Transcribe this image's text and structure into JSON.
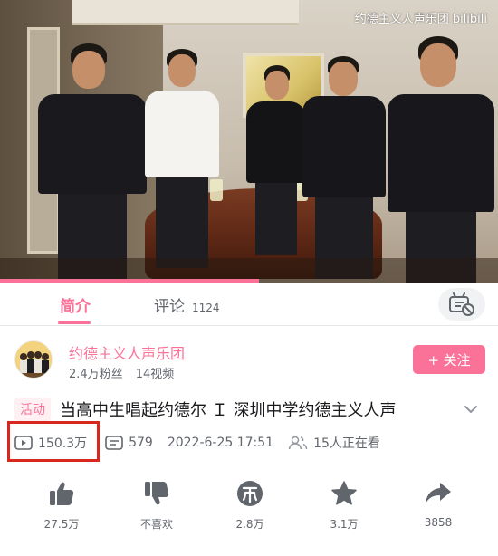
{
  "video": {
    "watermark": "约德主义人声乐团 bilibili",
    "progress_fraction": 0.52
  },
  "tabs": [
    {
      "label": "简介",
      "active": true
    },
    {
      "label": "评论",
      "count": "1124",
      "active": false
    }
  ],
  "uploader": {
    "name": "约德主义人声乐团",
    "fans": "2.4万粉丝",
    "videos": "14视频",
    "follow_label": "+ 关注"
  },
  "title": {
    "tag": "活动",
    "text": "当高中生唱起约德尔 Ｉ 深圳中学约德主义人声"
  },
  "stats": {
    "plays": "150.3万",
    "danmaku": "579",
    "date": "2022-6-25 17:51",
    "watching": "15人正在看"
  },
  "actions": [
    {
      "icon": "thumbs-up-icon",
      "label": "27.5万"
    },
    {
      "icon": "thumbs-down-icon",
      "label": "不喜欢"
    },
    {
      "icon": "coin-icon",
      "label": "2.8万"
    },
    {
      "icon": "star-icon",
      "label": "3.1万"
    },
    {
      "icon": "share-icon",
      "label": "3858"
    }
  ],
  "colors": {
    "accent": "#fb7299",
    "highlight": "#d8281e",
    "secondary_text": "#61666d"
  }
}
